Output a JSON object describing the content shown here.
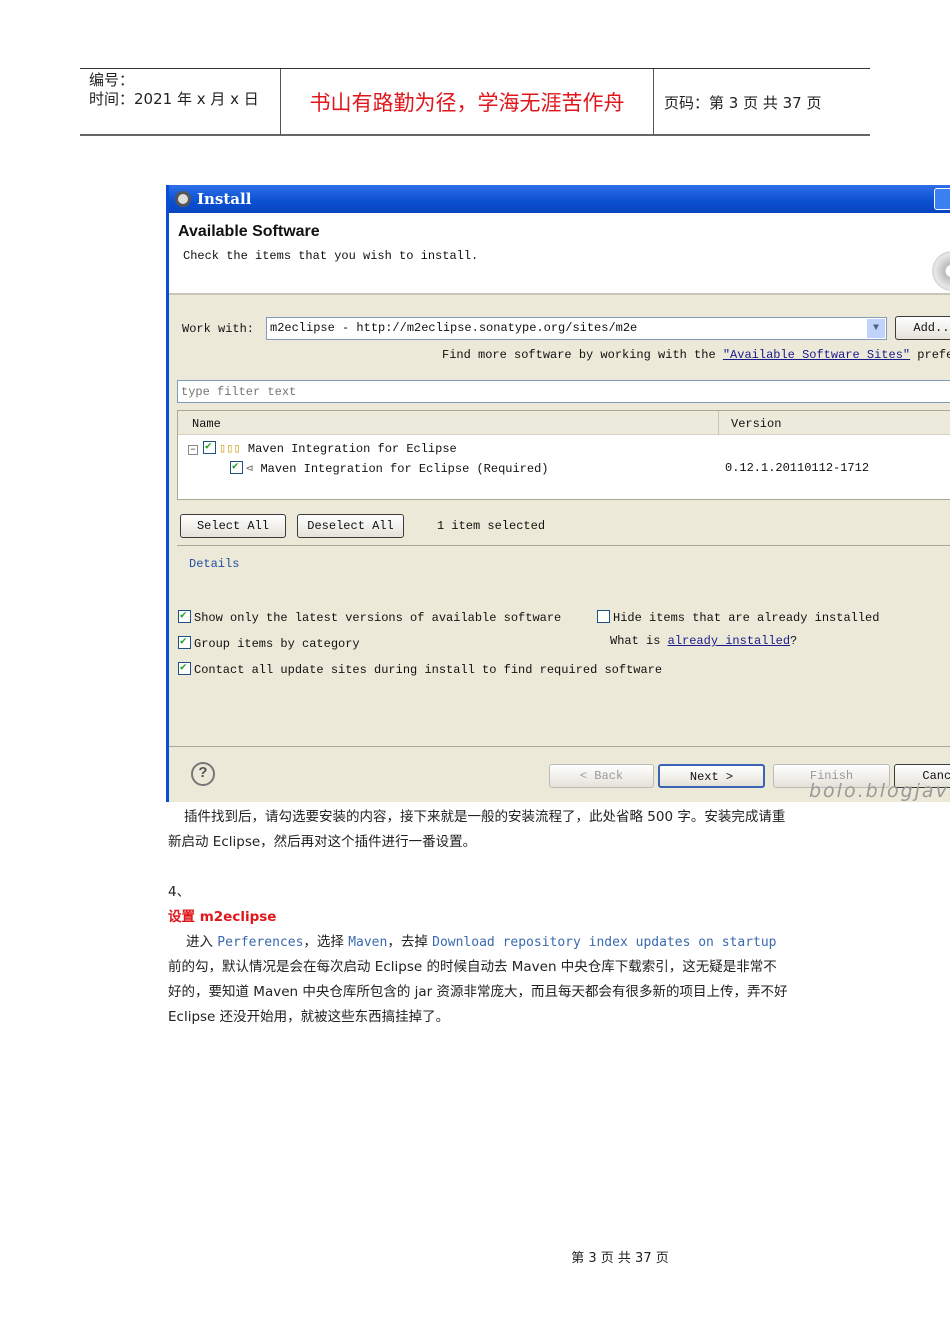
{
  "header": {
    "number_label": "编号：",
    "time_label": "时间：2021 年 x 月 x 日",
    "motto": "书山有路勤为径，学海无涯苦作舟",
    "page_label": "页码：第 3 页  共 37 页"
  },
  "dialog": {
    "title": "Install",
    "heading": "Available Software",
    "subheading": "Check the items that you wish to install.",
    "work_with_label": "Work with:",
    "work_with_value": "m2eclipse - http://m2eclipse.sonatype.org/sites/m2e",
    "add_button": "Add...",
    "find_more_prefix": "Find more software by working with the",
    "find_more_link": "\"Available Software Sites\"",
    "find_more_suffix": "preferences.",
    "filter_placeholder": "type filter text",
    "columns": {
      "name": "Name",
      "version": "Version"
    },
    "tree": [
      {
        "name": "Maven Integration for Eclipse",
        "version": "",
        "checked": true
      },
      {
        "name": "Maven Integration for Eclipse (Required)",
        "version": "0.12.1.20110112-1712",
        "checked": true
      }
    ],
    "select_all": "Select All",
    "deselect_all": "Deselect All",
    "selected_count": "1 item selected",
    "details_label": "Details",
    "options": {
      "latest": "Show only the latest versions of available software",
      "hide": "Hide items that are already installed",
      "group": "Group items by category",
      "what_is": "What is",
      "already_installed": "already installed",
      "contact": "Contact all update sites during install to find required software"
    },
    "back": "< Back",
    "next": "Next >",
    "finish": "Finish",
    "cancel": "Cancel",
    "watermark": "bolo.blogjava"
  },
  "body": {
    "p1": "插件找到后，请勾选要安装的内容，接下来就是一般的安装流程了，此处省略 500 字。安装完成请重新启动 Eclipse，然后再对这个插件进行一番设置。",
    "step": "4、",
    "section_title": "设置 m2eclipse",
    "p2_a": "进入 ",
    "p2_b": "Perferences",
    "p2_c": "，选择 ",
    "p2_d": "Maven",
    "p2_e": "，去掉 ",
    "p2_f": "Download repository index updates on startup",
    "p2_g": " 前的勾，默认情况是会在每次启动 Eclipse 的时候自动去 Maven 中央仓库下载索引，这无疑是非常不好的，要知道 Maven 中央仓库所包含的 jar 资源非常庞大，而且每天都会有很多新的项目上传，弄不好 Eclipse 还没开始用，就被这些东西搞挂掉了。"
  },
  "footer": "第 3 页 共 37 页"
}
